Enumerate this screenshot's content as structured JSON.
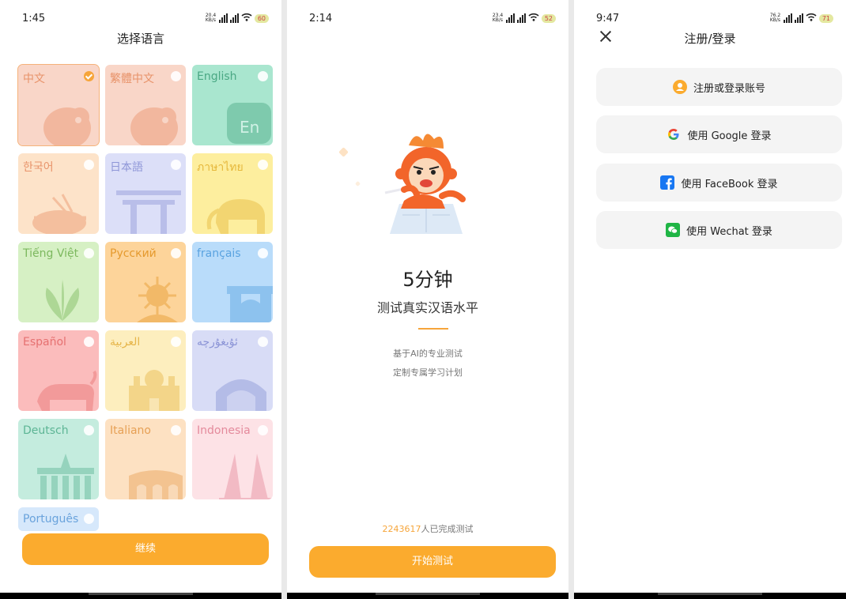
{
  "screen1": {
    "status": {
      "time": "1:45",
      "net": "20.4 KB/s",
      "battery": "60"
    },
    "title": "选择语言",
    "languages": [
      {
        "label": "中文",
        "selected": true,
        "color": "#f9d6c8",
        "text_color": "#e8936a"
      },
      {
        "label": "繁體中文",
        "selected": false,
        "color": "#f9d6c8",
        "text_color": "#e8936a"
      },
      {
        "label": "English",
        "selected": false,
        "color": "#a9e6cf",
        "text_color": "#4aa884"
      },
      {
        "label": "한국어",
        "selected": false,
        "color": "#fde3c9",
        "text_color": "#e8936a"
      },
      {
        "label": "日本語",
        "selected": false,
        "color": "#dcdff8",
        "text_color": "#8f97d8"
      },
      {
        "label": "ภาษาไทย",
        "selected": false,
        "color": "#fdee9e",
        "text_color": "#e5b73a"
      },
      {
        "label": "Tiếng Việt",
        "selected": false,
        "color": "#d6f0c4",
        "text_color": "#7cb85e"
      },
      {
        "label": "Русский",
        "selected": false,
        "color": "#fdd49a",
        "text_color": "#e59a2e"
      },
      {
        "label": "français",
        "selected": false,
        "color": "#b9dcfa",
        "text_color": "#5aa3e0"
      },
      {
        "label": "Español",
        "selected": false,
        "color": "#fbbcbc",
        "text_color": "#e67171"
      },
      {
        "label": "العربية",
        "selected": false,
        "color": "#fdeebe",
        "text_color": "#e6b54a"
      },
      {
        "label": "ئۇيغۇرچە",
        "selected": false,
        "color": "#d8dcf6",
        "text_color": "#8b94d6"
      },
      {
        "label": "Deutsch",
        "selected": false,
        "color": "#c4ecde",
        "text_color": "#5db595"
      },
      {
        "label": "Italiano",
        "selected": false,
        "color": "#fde1c2",
        "text_color": "#e6a055"
      },
      {
        "label": "Indonesia",
        "selected": false,
        "color": "#fde2e6",
        "text_color": "#e48a9c"
      },
      {
        "label": "Português",
        "selected": false,
        "color": "#d6e8fb",
        "text_color": "#6aa3dc"
      }
    ],
    "continue_label": "继续"
  },
  "screen2": {
    "status": {
      "time": "2:14",
      "net": "23.4 KB/s",
      "battery": "52"
    },
    "title": "5分钟",
    "subtitle": "测试真实汉语水平",
    "desc1": "基于AI的专业测试",
    "desc2": "定制专属学习计划",
    "count_number": "2243617",
    "count_suffix": "人已完成测试",
    "start_label": "开始测试"
  },
  "screen3": {
    "status": {
      "time": "9:47",
      "net": "76.2 KB/s",
      "battery": "71"
    },
    "title": "注册/登录",
    "buttons": [
      {
        "label": "注册或登录账号",
        "icon": "user-icon"
      },
      {
        "label": "使用 Google 登录",
        "icon": "google-icon"
      },
      {
        "label": "使用 FaceBook 登录",
        "icon": "facebook-icon"
      },
      {
        "label": "使用 Wechat 登录",
        "icon": "wechat-icon"
      }
    ]
  },
  "colors": {
    "accent": "#fbab2e",
    "button_bg": "#f4f4f4"
  }
}
